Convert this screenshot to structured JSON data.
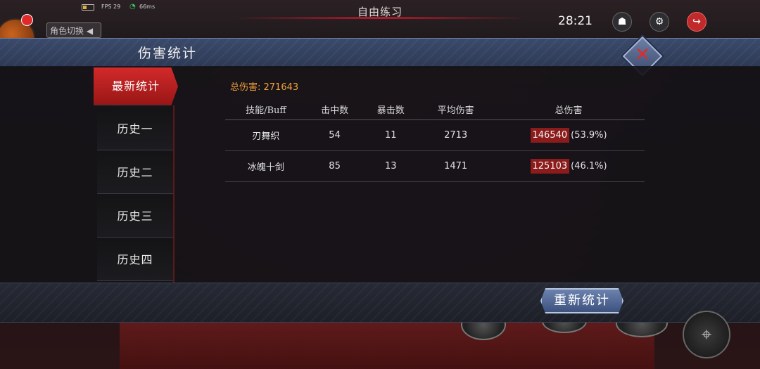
{
  "status_bar": {
    "fps": "FPS 29",
    "ping": "66ms",
    "mode_title": "自由练习",
    "clock": "28:21",
    "role_switch": "角色切换"
  },
  "panel": {
    "title": "伤害统计",
    "tabs": [
      {
        "label": "最新统计",
        "active": true
      },
      {
        "label": "历史一",
        "active": false
      },
      {
        "label": "历史二",
        "active": false
      },
      {
        "label": "历史三",
        "active": false
      },
      {
        "label": "历史四",
        "active": false
      }
    ],
    "total_damage_label": "总伤害: 271643",
    "columns": [
      "技能/Buff",
      "击中数",
      "暴击数",
      "平均伤害",
      "总伤害"
    ],
    "rows": [
      {
        "skill": "刃舞织",
        "hits": "54",
        "crits": "11",
        "avg": "2713",
        "total": "146540",
        "pct": "(53.9%)"
      },
      {
        "skill": "冰魄十剑",
        "hits": "85",
        "crits": "13",
        "avg": "1471",
        "total": "125103",
        "pct": "(46.1%)"
      }
    ],
    "reset_label": "重新统计"
  },
  "colors": {
    "accent_red": "#d22a2a",
    "total_label": "#f2a23c",
    "header_blue": "#3b4a6b"
  },
  "icons": [
    "battery-icon",
    "wifi-icon",
    "bag-icon",
    "gear-icon",
    "exit-icon",
    "close-icon",
    "crosshair-icon"
  ]
}
